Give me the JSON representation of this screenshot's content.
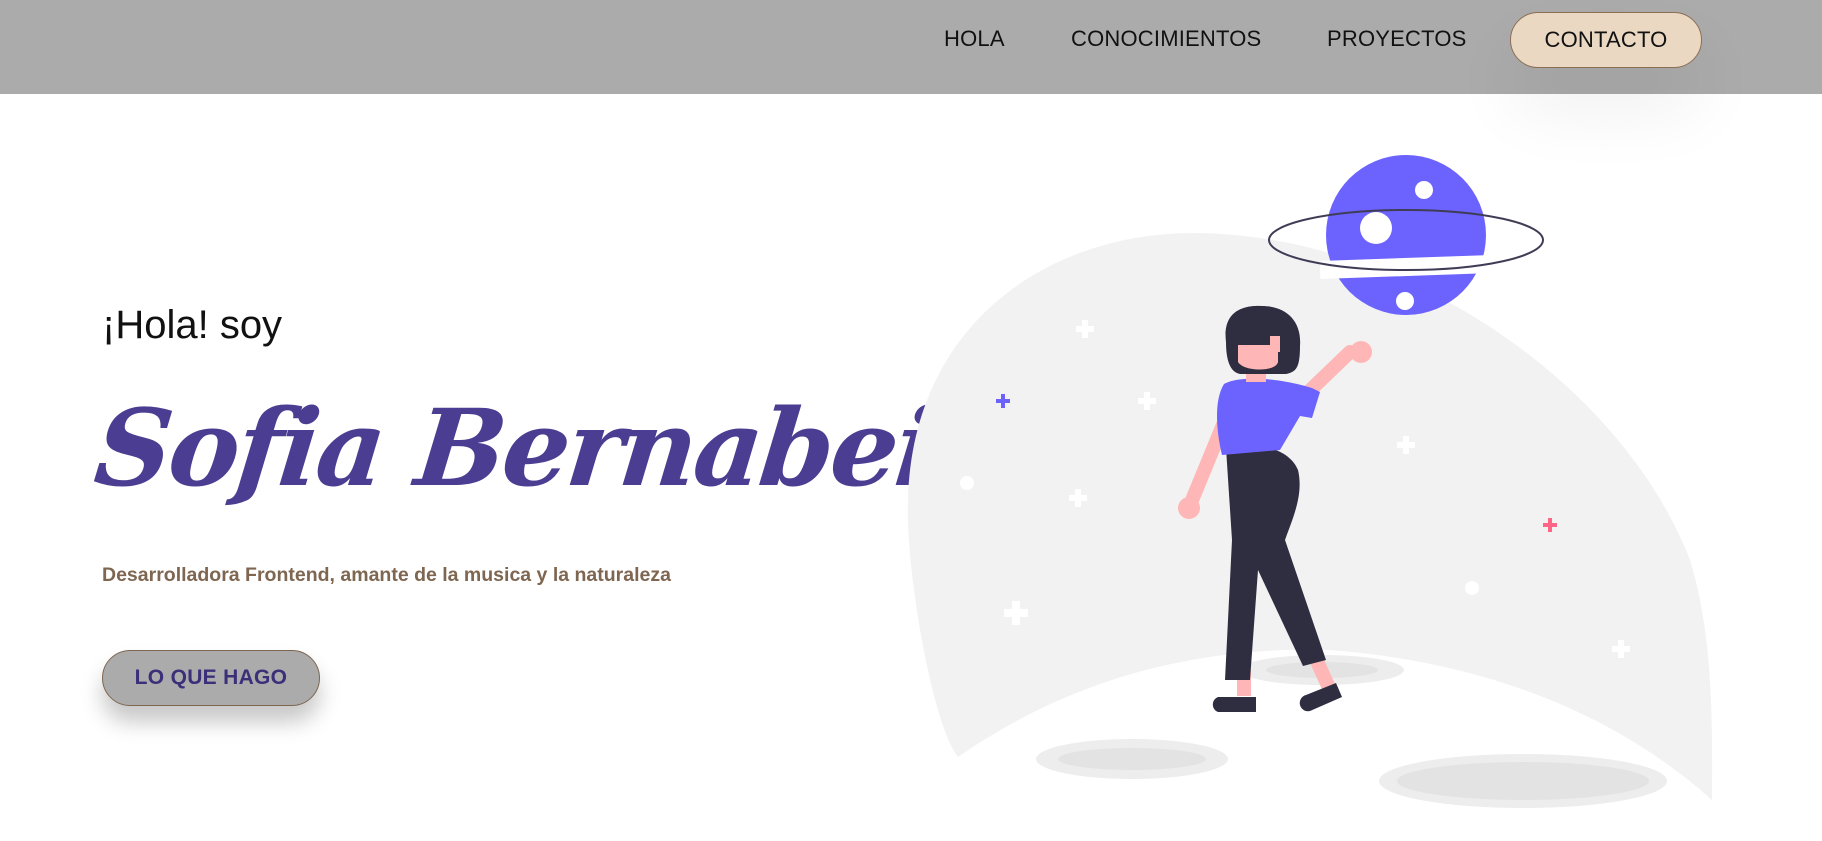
{
  "nav": {
    "items": [
      {
        "label": "HOLA"
      },
      {
        "label": "CONOCIMIENTOS"
      },
      {
        "label": "PROYECTOS"
      }
    ],
    "contact_label": "CONTACTO"
  },
  "hero": {
    "greeting": "¡Hola! soy",
    "name": "Sofia Bernabei",
    "tagline": "Desarrolladora Frontend, amante de la musica y la naturaleza",
    "cta_label": "LO QUE HAGO"
  },
  "colors": {
    "navbar_bg": "#ababab",
    "name_accent": "#4b3e92",
    "tagline": "#7e6650",
    "contact_bg": "#ead8c3",
    "illustration_primary": "#6c63ff",
    "illustration_dark": "#2f2e41",
    "illustration_skin": "#ffb6b6",
    "illustration_pink": "#ff6584"
  }
}
